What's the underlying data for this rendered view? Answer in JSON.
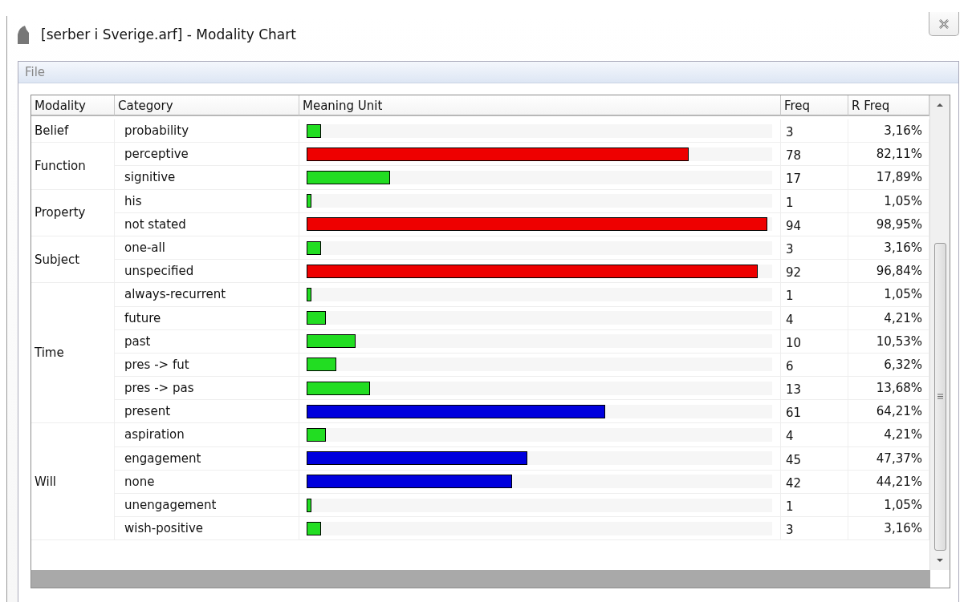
{
  "window": {
    "title": "[serber i Sverige.arf] - Modality Chart"
  },
  "menu": [
    "File"
  ],
  "table": {
    "columns": [
      "Modality",
      "Category",
      "Meaning Unit",
      "Freq",
      "R Freq"
    ],
    "groups": [
      {
        "modality": "Belief",
        "rows": [
          {
            "category": "probability",
            "level": 0.0316,
            "color": "#22dd22",
            "freq": "3",
            "rfreq": "3,16%"
          }
        ]
      },
      {
        "modality": "Function",
        "rows": [
          {
            "category": "perceptive",
            "level": 0.8211,
            "color": "#ee0000",
            "freq": "78",
            "rfreq": "82,11%"
          },
          {
            "category": "signitive",
            "level": 0.1789,
            "color": "#22dd22",
            "freq": "17",
            "rfreq": "17,89%"
          }
        ]
      },
      {
        "modality": "Property",
        "rows": [
          {
            "category": "his",
            "level": 0.0105,
            "color": "#22dd22",
            "freq": "1",
            "rfreq": "1,05%"
          },
          {
            "category": "not stated",
            "level": 0.9895,
            "color": "#ee0000",
            "freq": "94",
            "rfreq": "98,95%"
          }
        ]
      },
      {
        "modality": "Subject",
        "rows": [
          {
            "category": "one-all",
            "level": 0.0316,
            "color": "#22dd22",
            "freq": "3",
            "rfreq": "3,16%"
          },
          {
            "category": "unspecified",
            "level": 0.9684,
            "color": "#ee0000",
            "freq": "92",
            "rfreq": "96,84%"
          }
        ]
      },
      {
        "modality": "Time",
        "rows": [
          {
            "category": "always-recurrent",
            "level": 0.0105,
            "color": "#22dd22",
            "freq": "1",
            "rfreq": "1,05%"
          },
          {
            "category": "future",
            "level": 0.0421,
            "color": "#22dd22",
            "freq": "4",
            "rfreq": "4,21%"
          },
          {
            "category": "past",
            "level": 0.1053,
            "color": "#22dd22",
            "freq": "10",
            "rfreq": "10,53%"
          },
          {
            "category": "pres -> fut",
            "level": 0.0632,
            "color": "#22dd22",
            "freq": "6",
            "rfreq": "6,32%"
          },
          {
            "category": "pres -> pas",
            "level": 0.1368,
            "color": "#22dd22",
            "freq": "13",
            "rfreq": "13,68%"
          },
          {
            "category": "present",
            "level": 0.6421,
            "color": "#0000dd",
            "freq": "61",
            "rfreq": "64,21%"
          }
        ]
      },
      {
        "modality": "Will",
        "rows": [
          {
            "category": "aspiration",
            "level": 0.0421,
            "color": "#22dd22",
            "freq": "4",
            "rfreq": "4,21%"
          },
          {
            "category": "engagement",
            "level": 0.4737,
            "color": "#0000dd",
            "freq": "45",
            "rfreq": "47,37%"
          },
          {
            "category": "none",
            "level": 0.4421,
            "color": "#0000dd",
            "freq": "42",
            "rfreq": "44,21%"
          },
          {
            "category": "unengagement",
            "level": 0.0105,
            "color": "#22dd22",
            "freq": "1",
            "rfreq": "1,05%"
          },
          {
            "category": "wish-positive",
            "level": 0.0316,
            "color": "#22dd22",
            "freq": "3",
            "rfreq": "3,16%"
          }
        ]
      }
    ]
  }
}
